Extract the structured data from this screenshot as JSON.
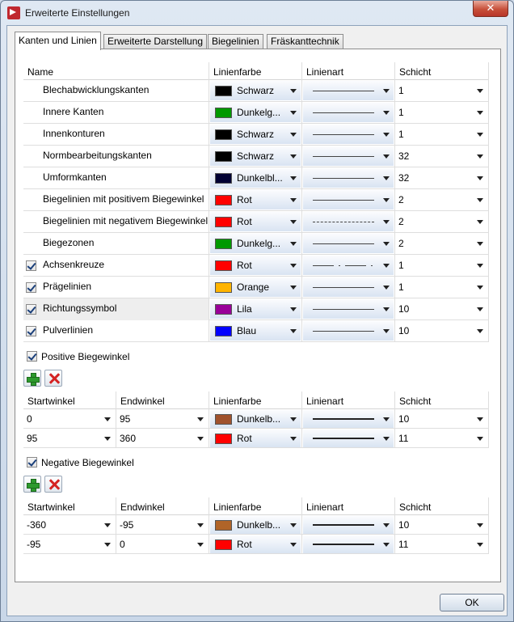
{
  "window": {
    "title": "Erweiterte Einstellungen",
    "close_glyph": "✕"
  },
  "tabs": [
    {
      "label": "Kanten und Linien",
      "active": true
    },
    {
      "label": "Erweiterte Darstellung",
      "active": false
    },
    {
      "label": "Biegelinien",
      "active": false
    },
    {
      "label": "Fräskanttechnik",
      "active": false
    }
  ],
  "main_table": {
    "headers": [
      "Name",
      "Linienfarbe",
      "Linienart",
      "Schicht"
    ],
    "rows": [
      {
        "checkbox": false,
        "name": "Blechabwicklungskanten",
        "color_label": "Schwarz",
        "color_hex": "#000000",
        "linetype": "solid",
        "layer": "1"
      },
      {
        "checkbox": false,
        "name": "Innere Kanten",
        "color_label": "Dunkelg...",
        "color_hex": "#009900",
        "linetype": "solid",
        "layer": "1"
      },
      {
        "checkbox": false,
        "name": "Innenkonturen",
        "color_label": "Schwarz",
        "color_hex": "#000000",
        "linetype": "solid",
        "layer": "1"
      },
      {
        "checkbox": false,
        "name": "Normbearbeitungskanten",
        "color_label": "Schwarz",
        "color_hex": "#000000",
        "linetype": "solid",
        "layer": "32"
      },
      {
        "checkbox": false,
        "name": "Umformkanten",
        "color_label": "Dunkelbl...",
        "color_hex": "#000033",
        "linetype": "solid",
        "layer": "32"
      },
      {
        "checkbox": false,
        "name": "Biegelinien mit positivem Biegewinkel",
        "color_label": "Rot",
        "color_hex": "#ff0000",
        "linetype": "solid",
        "layer": "2"
      },
      {
        "checkbox": false,
        "name": "Biegelinien mit negativem Biegewinkel",
        "color_label": "Rot",
        "color_hex": "#ff0000",
        "linetype": "dashed",
        "layer": "2"
      },
      {
        "checkbox": false,
        "name": "Biegezonen",
        "color_label": "Dunkelg...",
        "color_hex": "#009900",
        "linetype": "solid",
        "layer": "2"
      },
      {
        "checkbox": true,
        "name": "Achsenkreuze",
        "color_label": "Rot",
        "color_hex": "#ff0000",
        "linetype": "dashdot",
        "layer": "1"
      },
      {
        "checkbox": true,
        "name": "Prägelinien",
        "color_label": "Orange",
        "color_hex": "#ffb400",
        "linetype": "solid",
        "layer": "1"
      },
      {
        "checkbox": true,
        "name": "Richtungssymbol",
        "color_label": "Lila",
        "color_hex": "#990099",
        "linetype": "solid",
        "layer": "10",
        "highlight": true
      },
      {
        "checkbox": true,
        "name": "Pulverlinien",
        "color_label": "Blau",
        "color_hex": "#0000ff",
        "linetype": "solid",
        "layer": "10"
      }
    ]
  },
  "positive_group": {
    "label": "Positive Biegewinkel",
    "checked": true,
    "headers": [
      "Startwinkel",
      "Endwinkel",
      "Linienfarbe",
      "Linienart",
      "Schicht"
    ],
    "rows": [
      {
        "start": "0",
        "end": "95",
        "color_label": "Dunkelb...",
        "color_hex": "#a0522d",
        "linetype": "solid-thick",
        "layer": "10"
      },
      {
        "start": "95",
        "end": "360",
        "color_label": "Rot",
        "color_hex": "#ff0000",
        "linetype": "solid-thick",
        "layer": "11"
      }
    ]
  },
  "negative_group": {
    "label": "Negative Biegewinkel",
    "checked": true,
    "headers": [
      "Startwinkel",
      "Endwinkel",
      "Linienfarbe",
      "Linienart",
      "Schicht"
    ],
    "rows": [
      {
        "start": "-360",
        "end": "-95",
        "color_label": "Dunkelb...",
        "color_hex": "#b06428",
        "linetype": "solid-thick",
        "layer": "10"
      },
      {
        "start": "-95",
        "end": "0",
        "color_label": "Rot",
        "color_hex": "#ff0000",
        "linetype": "solid-thick",
        "layer": "11"
      }
    ]
  },
  "footer": {
    "ok_label": "OK"
  }
}
